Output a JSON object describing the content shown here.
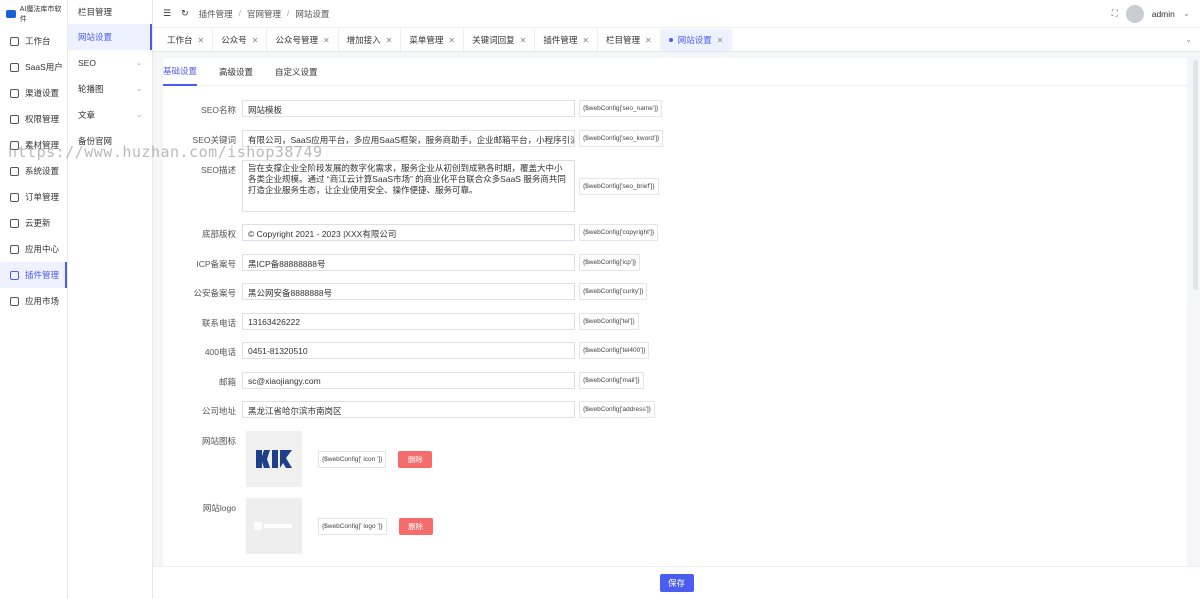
{
  "app": {
    "logo_text": "AI魔法库市软件"
  },
  "nav1": [
    {
      "label": "工作台",
      "icon": "monitor-icon"
    },
    {
      "label": "SaaS用户",
      "icon": "user-icon"
    },
    {
      "label": "渠道设置",
      "icon": "channel-icon"
    },
    {
      "label": "权限管理",
      "icon": "lock-icon"
    },
    {
      "label": "素材管理",
      "icon": "image-icon"
    },
    {
      "label": "系统设置",
      "icon": "gear-icon"
    },
    {
      "label": "订单管理",
      "icon": "order-icon"
    },
    {
      "label": "云更新",
      "icon": "rocket-icon"
    },
    {
      "label": "应用中心",
      "icon": "app-icon"
    },
    {
      "label": "插件管理",
      "icon": "plugin-icon",
      "active": true
    },
    {
      "label": "应用市场",
      "icon": "market-icon"
    }
  ],
  "nav2": [
    {
      "label": "栏目管理"
    },
    {
      "label": "网站设置",
      "active": true
    },
    {
      "label": "SEO",
      "chevron": true
    },
    {
      "label": "轮播图",
      "chevron": true
    },
    {
      "label": "文章",
      "chevron": true
    },
    {
      "label": "备份官网"
    }
  ],
  "topbar": {
    "breadcrumb": [
      "插件管理",
      "官网管理",
      "网站设置"
    ],
    "user": "admin"
  },
  "tabs": [
    {
      "label": "工作台"
    },
    {
      "label": "公众号"
    },
    {
      "label": "公众号管理"
    },
    {
      "label": "增加接入"
    },
    {
      "label": "菜单管理"
    },
    {
      "label": "关键词回复"
    },
    {
      "label": "插件管理"
    },
    {
      "label": "栏目管理"
    },
    {
      "label": "网站设置",
      "active": true
    }
  ],
  "subtabs": [
    "基础设置",
    "高级设置",
    "自定义设置"
  ],
  "form": {
    "seo_name": {
      "label": "SEO名称",
      "value": "网站模板",
      "tag": "{$webConfig['seo_name']}"
    },
    "seo_kword": {
      "label": "SEO关键词",
      "value": "有限公司，SaaS应用平台，多应用SaaS框架，服务商助手，企业邮箱平台，小程序引流",
      "tag": "{$webConfig['seo_kword']}"
    },
    "seo_brief": {
      "label": "SEO描述",
      "value": "旨在支撑企业全阶段发展的数字化需求，服务企业从初创到成熟各时期，覆盖大中小各类企业规模。通过 “商江云计算SaaS市场” 的商业化平台联合众多SaaS 服务商共同打造企业服务生态，让企业使用安全、操作便捷、服务可靠。",
      "tag": "{$webConfig['seo_brief']}"
    },
    "copyright": {
      "label": "底部版权",
      "value": "© Copyright 2021 - 2023 |XXX有限公司",
      "tag": "{$webConfig['copyright']}"
    },
    "icp": {
      "label": "ICP备案号",
      "value": "黑ICP备88888888号",
      "tag": "{$webConfig['icp']}"
    },
    "curity": {
      "label": "公安备案号",
      "value": "黑公网安备8888888号",
      "tag": "{$webConfig['curity']}"
    },
    "tel": {
      "label": "联系电话",
      "value": "13163426222",
      "tag": "{$webConfig['tel']}"
    },
    "tel400": {
      "label": "400电话",
      "value": "0451-81320510",
      "tag": "{$webConfig['tel400']}"
    },
    "mail": {
      "label": "邮箱",
      "value": "sc@xiaojiangy.com",
      "tag": "{$webConfig['mail']}"
    },
    "address": {
      "label": "公司地址",
      "value": "黑龙江省哈尔滨市南岗区",
      "tag": "{$webConfig['address']}"
    },
    "icon": {
      "label": "网站图标",
      "tag": "{$webConfig[' icon ']}",
      "delete": "删除"
    },
    "logo": {
      "label": "网站logo",
      "tag": "{$webConfig[' logo ']}",
      "delete": "删除"
    }
  },
  "save_label": "保存",
  "watermark": "https://www.huzhan.com/ishop38749",
  "colors": {
    "accent": "#4b5cf0",
    "danger": "#f56c6c"
  }
}
